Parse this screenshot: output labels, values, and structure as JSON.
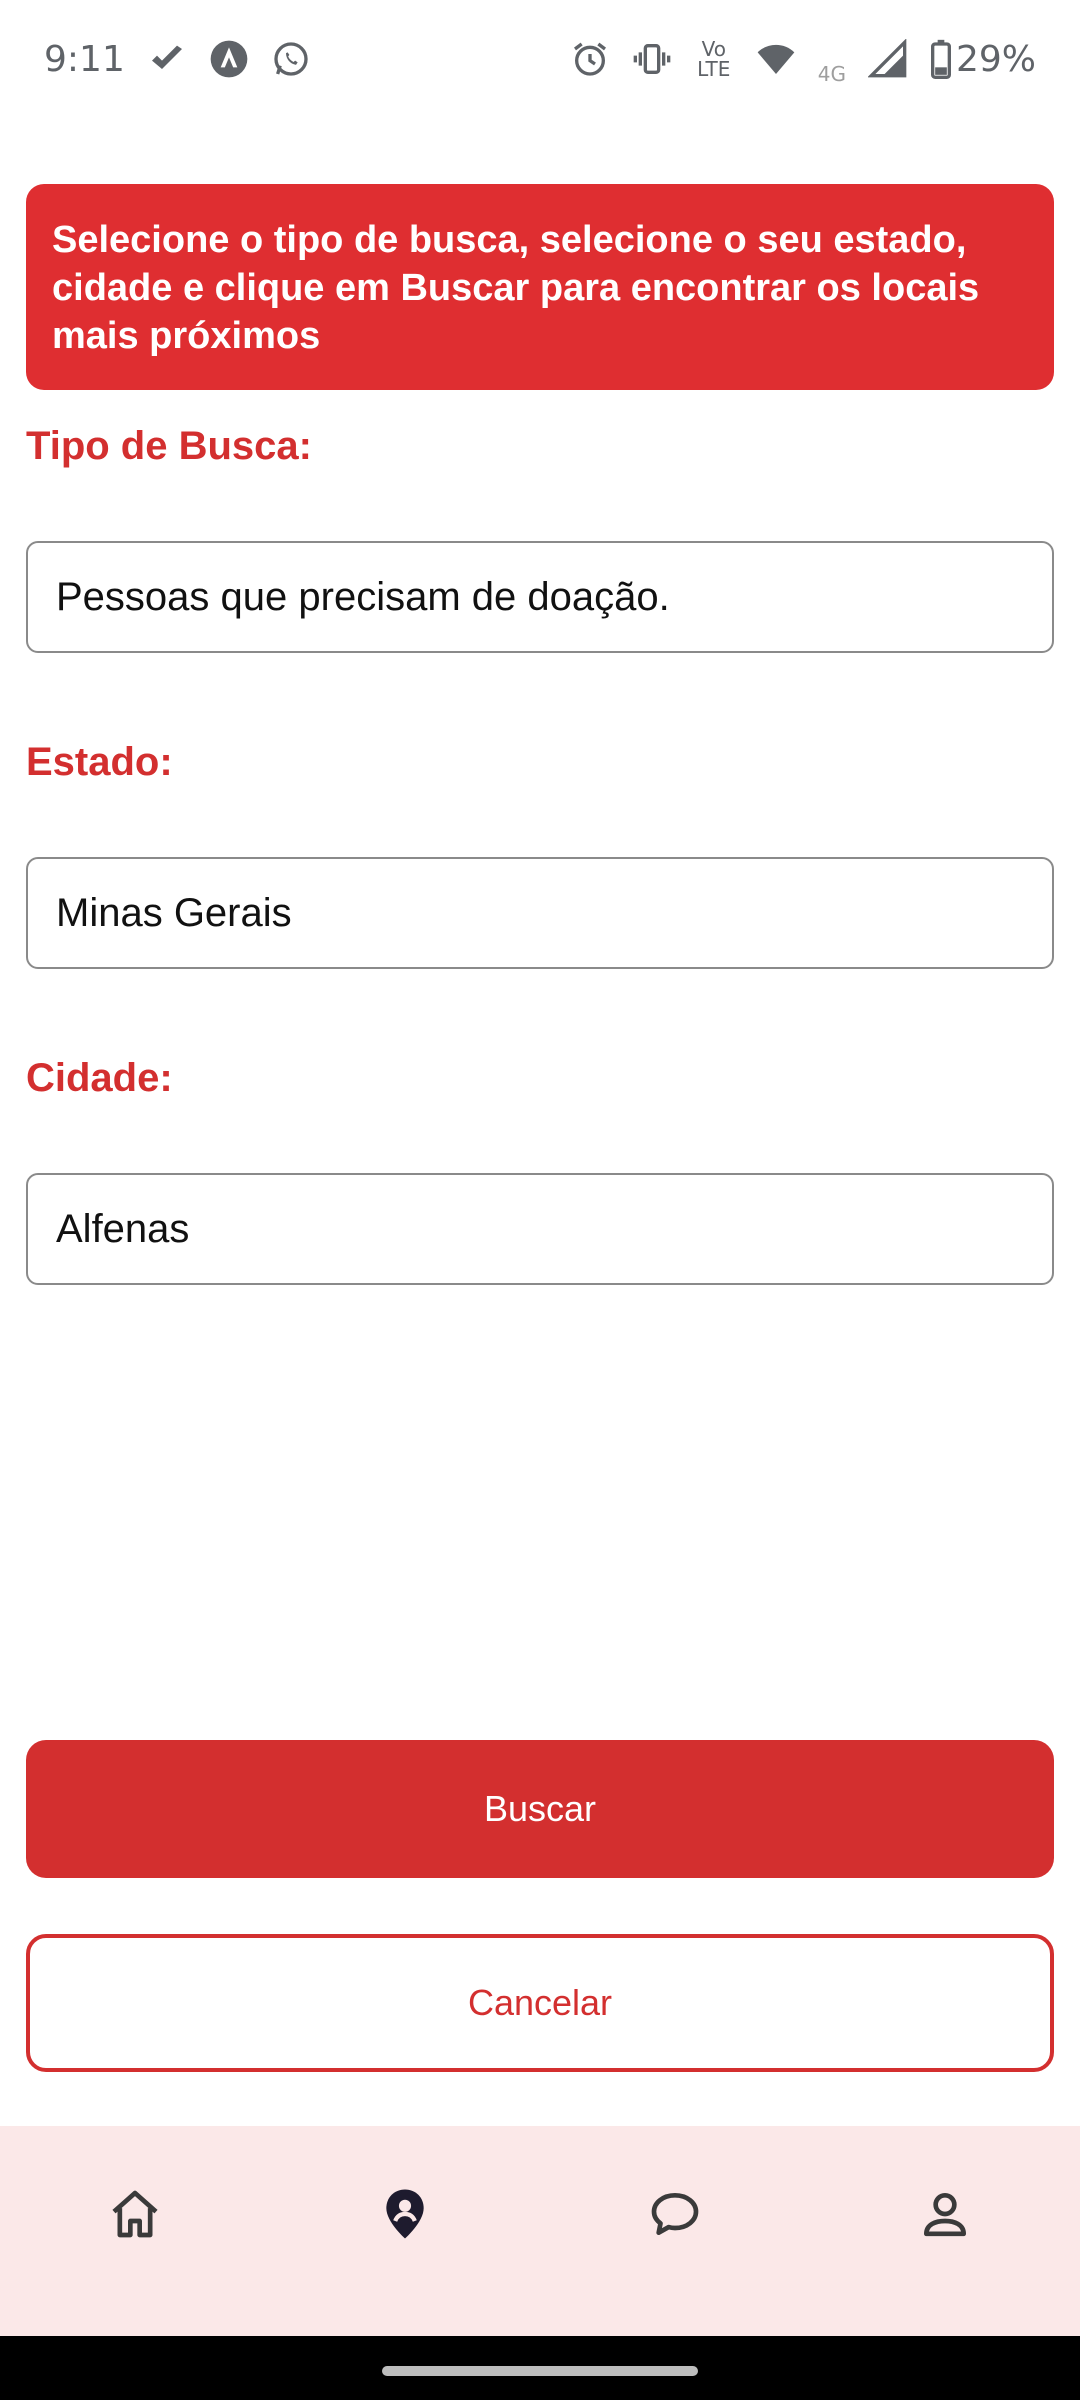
{
  "status_bar": {
    "time": "9:11",
    "battery": "29%",
    "network_small": "4G",
    "volte_line1": "Vo",
    "volte_line2": "LTE",
    "icons": [
      "check-icon",
      "app-icon",
      "whatsapp-icon",
      "alarm-icon",
      "vibrate-icon",
      "volte-icon",
      "wifi-icon",
      "signal-icon",
      "battery-icon"
    ]
  },
  "banner": {
    "text": "Selecione o tipo de busca, selecione o seu estado, cidade e clique em Buscar para encontrar os locais mais próximos"
  },
  "form": {
    "tipo": {
      "label": "Tipo de Busca:",
      "value": "Pessoas que precisam de doação."
    },
    "estado": {
      "label": "Estado:",
      "value": "Minas Gerais"
    },
    "cidade": {
      "label": "Cidade:",
      "value": "Alfenas"
    }
  },
  "actions": {
    "search_label": "Buscar",
    "cancel_label": "Cancelar"
  },
  "bottom_nav": {
    "items": [
      {
        "icon": "home-icon",
        "active": false
      },
      {
        "icon": "location-pin-icon",
        "active": true
      },
      {
        "icon": "chat-icon",
        "active": false
      },
      {
        "icon": "profile-icon",
        "active": false
      }
    ]
  },
  "colors": {
    "primary": "#d32f2f",
    "banner": "#df2e31",
    "nav_background": "#fbe8e8"
  }
}
